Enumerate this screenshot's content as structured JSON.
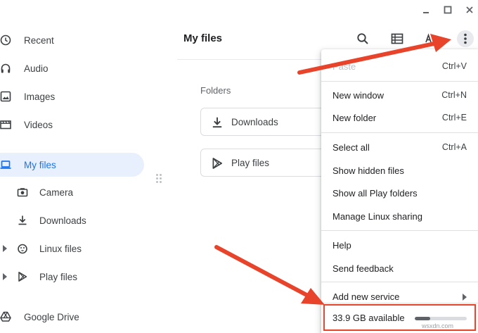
{
  "window": {
    "controls": [
      {
        "name": "minimize-icon"
      },
      {
        "name": "maximize-icon"
      },
      {
        "name": "close-icon"
      }
    ]
  },
  "sidebar": {
    "items": [
      {
        "label": "Recent",
        "icon": "clock-icon"
      },
      {
        "label": "Audio",
        "icon": "headphones-icon"
      },
      {
        "label": "Images",
        "icon": "image-icon"
      },
      {
        "label": "Videos",
        "icon": "film-icon"
      },
      {
        "label": "My files",
        "icon": "laptop-icon",
        "active": true
      },
      {
        "label": "Camera",
        "icon": "camera-icon"
      },
      {
        "label": "Downloads",
        "icon": "download-icon"
      },
      {
        "label": "Linux files",
        "icon": "penguin-icon"
      },
      {
        "label": "Play files",
        "icon": "play-store-icon"
      },
      {
        "label": "Google Drive",
        "icon": "drive-icon"
      }
    ]
  },
  "main": {
    "title": "My files",
    "section_label": "Folders",
    "folders": [
      {
        "label": "Downloads",
        "icon": "download-icon"
      },
      {
        "label": "Play files",
        "icon": "play-store-icon"
      }
    ],
    "toolbar": [
      "search-icon",
      "list-view-icon",
      "sort-icon",
      "more-vert-icon"
    ]
  },
  "menu": {
    "items": [
      {
        "label": "Paste",
        "shortcut": "Ctrl+V"
      },
      {
        "label": "New window",
        "shortcut": "Ctrl+N"
      },
      {
        "label": "New folder",
        "shortcut": "Ctrl+E"
      },
      {
        "label": "Select all",
        "shortcut": "Ctrl+A"
      },
      {
        "label": "Show hidden files",
        "shortcut": ""
      },
      {
        "label": "Show all Play folders",
        "shortcut": ""
      },
      {
        "label": "Manage Linux sharing",
        "shortcut": ""
      },
      {
        "label": "Help",
        "shortcut": ""
      },
      {
        "label": "Send feedback",
        "shortcut": ""
      },
      {
        "label": "Add new service",
        "shortcut": ""
      }
    ],
    "storage": {
      "label": "33.9 GB available",
      "used_fraction": 0.3
    }
  },
  "watermark": "wsxdn.com",
  "colors": {
    "accent": "#1a73e8",
    "active_bg": "#e8f0fe",
    "annotation": "#e8432b"
  }
}
